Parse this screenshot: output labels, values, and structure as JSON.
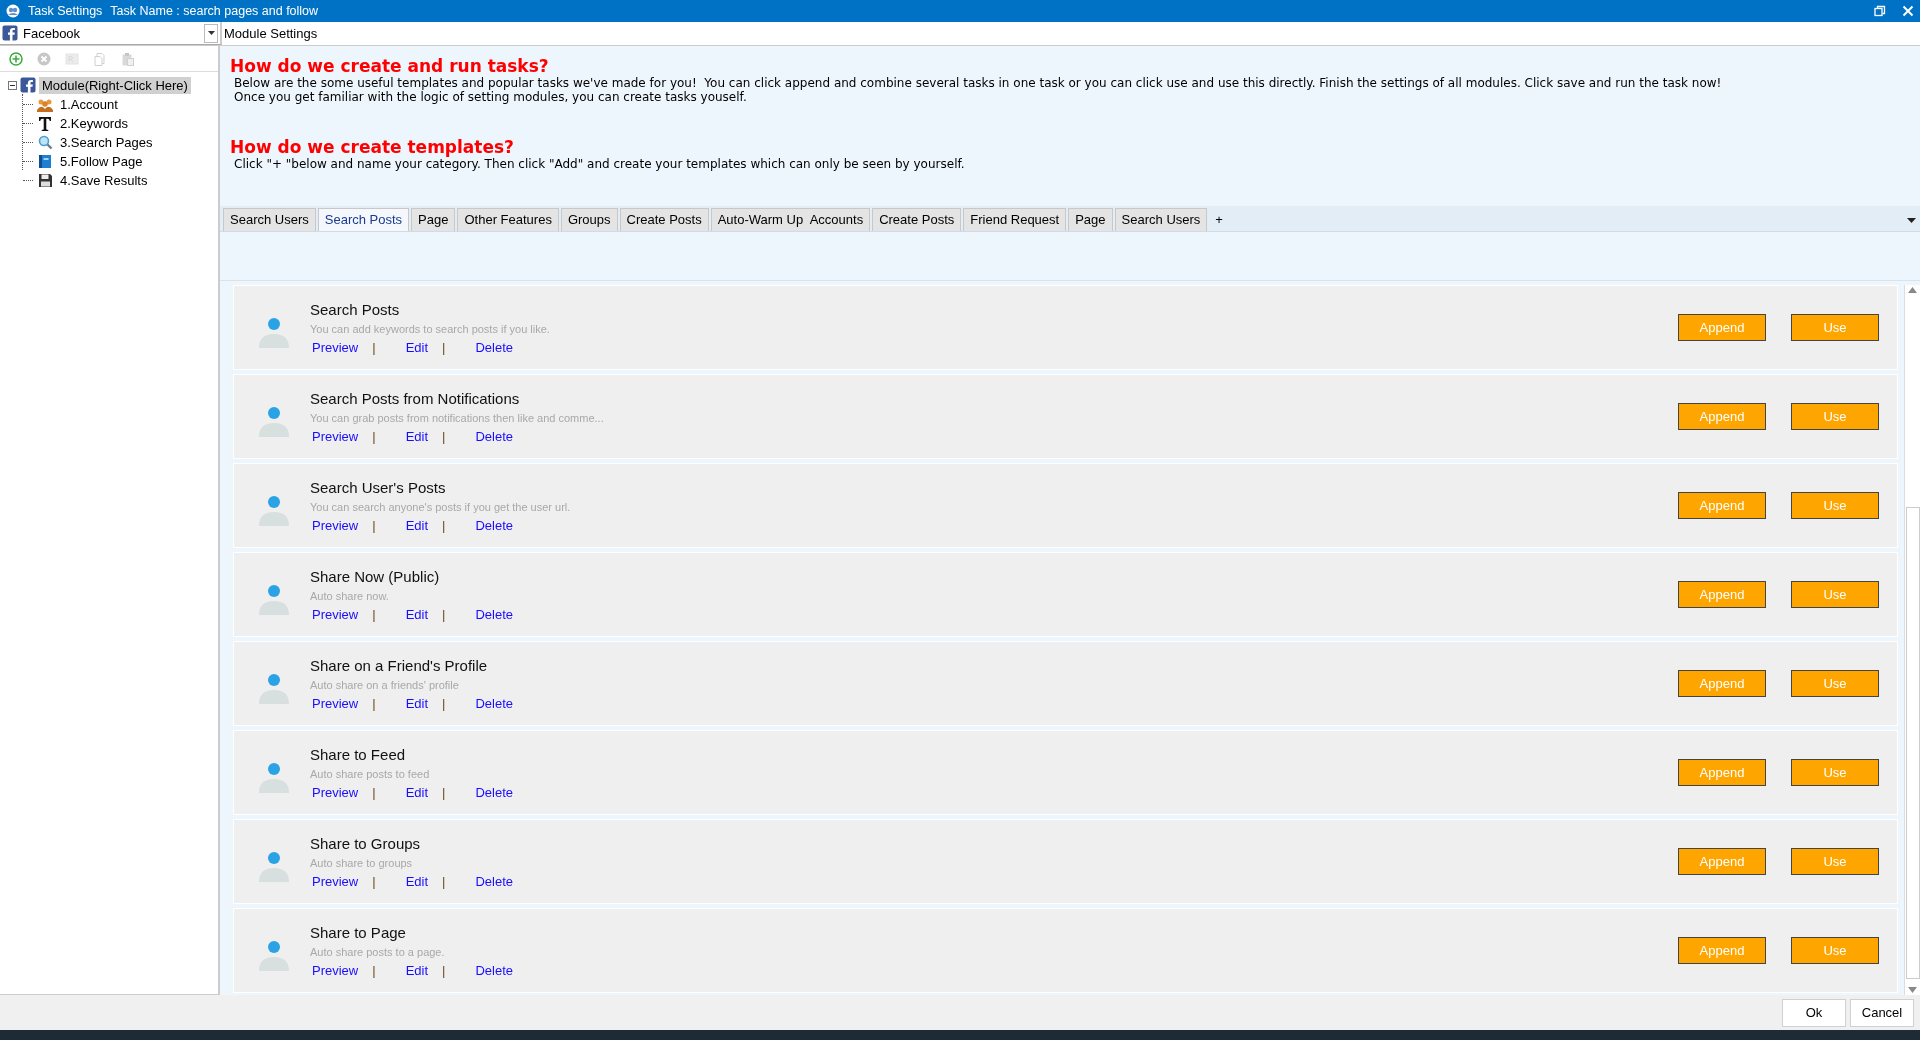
{
  "window": {
    "title": "Task Settings",
    "task_name": "Task Name : search pages and follow"
  },
  "module_selector": {
    "value": "Facebook"
  },
  "panel_title": "Module Settings",
  "toolbar": [
    {
      "kind": "add",
      "disabled": false
    },
    {
      "kind": "remove",
      "disabled": true
    },
    {
      "kind": "rename",
      "disabled": true
    },
    {
      "kind": "copy",
      "disabled": true
    },
    {
      "kind": "paste",
      "disabled": true
    }
  ],
  "tree": {
    "label": "Module(Right-Click Here)",
    "selected": true,
    "expanded": true,
    "children": [
      {
        "label": "1.Account",
        "kind": "account"
      },
      {
        "label": "2.Keywords",
        "kind": "keywords"
      },
      {
        "label": "3.Search Pages",
        "kind": "search"
      },
      {
        "label": "5.Follow Page",
        "kind": "book"
      },
      {
        "label": "4.Save Results",
        "kind": "save"
      }
    ]
  },
  "help": [
    {
      "heading": "How do we create and run tasks?",
      "lines": [
        "Below are the some useful templates and popular tasks we've made for you!  You can click append and combine several tasks in one task or you can click use and use this directly. Finish the settings of all modules. Click save and run the task now!",
        "Once you get familiar with the logic of setting modules, you can create tasks youself."
      ]
    },
    {
      "heading": "How do we create templates?",
      "lines": [
        "Click \"+ \"below and name your category. Then click \"Add\" and create your templates which can only be seen by yourself."
      ]
    }
  ],
  "tabs": [
    {
      "label": "Search Users",
      "selected": false
    },
    {
      "label": "Search Posts",
      "selected": true
    },
    {
      "label": "Page",
      "selected": false
    },
    {
      "label": "Other Features",
      "selected": false
    },
    {
      "label": "Groups",
      "selected": false
    },
    {
      "label": "Create Posts",
      "selected": false
    },
    {
      "label": "Auto-Warm Up  Accounts",
      "selected": false
    },
    {
      "label": "Create Posts",
      "selected": false
    },
    {
      "label": "Friend Request",
      "selected": false
    },
    {
      "label": "Page",
      "selected": false
    },
    {
      "label": "Search Users",
      "selected": false
    }
  ],
  "add_tab": "+",
  "templates": [
    {
      "title": "Search Posts",
      "description": "You can add keywords to search posts if you like.",
      "actions": [
        {
          "kind": "link",
          "text": "Preview"
        },
        {
          "kind": "separator",
          "text": "|"
        },
        {
          "kind": "link",
          "text": "Edit"
        },
        {
          "kind": "separator",
          "text": "|"
        },
        {
          "kind": "link",
          "text": "Delete"
        }
      ],
      "buttons": [
        "Append",
        "Use"
      ]
    },
    {
      "title": "Search Posts from Notifications",
      "description": "You can grab posts from notifications then like and comme...",
      "actions": [
        {
          "kind": "link",
          "text": "Preview"
        },
        {
          "kind": "separator",
          "text": "|"
        },
        {
          "kind": "link",
          "text": "Edit"
        },
        {
          "kind": "separator",
          "text": "|"
        },
        {
          "kind": "link",
          "text": "Delete"
        }
      ],
      "buttons": [
        "Append",
        "Use"
      ]
    },
    {
      "title": "Search User's Posts",
      "description": "You can search anyone's posts if you get the user url.",
      "actions": [
        {
          "kind": "link",
          "text": "Preview"
        },
        {
          "kind": "separator",
          "text": "|"
        },
        {
          "kind": "link",
          "text": "Edit"
        },
        {
          "kind": "separator",
          "text": "|"
        },
        {
          "kind": "link",
          "text": "Delete"
        }
      ],
      "buttons": [
        "Append",
        "Use"
      ]
    },
    {
      "title": "Share Now (Public)",
      "description": "Auto share now.",
      "actions": [
        {
          "kind": "link",
          "text": "Preview"
        },
        {
          "kind": "separator",
          "text": "|"
        },
        {
          "kind": "link",
          "text": "Edit"
        },
        {
          "kind": "separator",
          "text": "|"
        },
        {
          "kind": "link",
          "text": "Delete"
        }
      ],
      "buttons": [
        "Append",
        "Use"
      ]
    },
    {
      "title": "Share on a Friend's Profile",
      "description": "Auto share on a friends' profile",
      "actions": [
        {
          "kind": "link",
          "text": "Preview"
        },
        {
          "kind": "separator",
          "text": "|"
        },
        {
          "kind": "link",
          "text": "Edit"
        },
        {
          "kind": "separator",
          "text": "|"
        },
        {
          "kind": "link",
          "text": "Delete"
        }
      ],
      "buttons": [
        "Append",
        "Use"
      ]
    },
    {
      "title": "Share to Feed",
      "description": "Auto share posts to feed",
      "actions": [
        {
          "kind": "link",
          "text": "Preview"
        },
        {
          "kind": "separator",
          "text": "|"
        },
        {
          "kind": "link",
          "text": "Edit"
        },
        {
          "kind": "separator",
          "text": "|"
        },
        {
          "kind": "link",
          "text": "Delete"
        }
      ],
      "buttons": [
        "Append",
        "Use"
      ]
    },
    {
      "title": "Share to Groups",
      "description": "Auto share to groups",
      "actions": [
        {
          "kind": "link",
          "text": "Preview"
        },
        {
          "kind": "separator",
          "text": "|"
        },
        {
          "kind": "link",
          "text": "Edit"
        },
        {
          "kind": "separator",
          "text": "|"
        },
        {
          "kind": "link",
          "text": "Delete"
        }
      ],
      "buttons": [
        "Append",
        "Use"
      ]
    },
    {
      "title": "Share to Page",
      "description": "Auto share posts to a page.",
      "actions": [
        {
          "kind": "link",
          "text": "Preview"
        },
        {
          "kind": "separator",
          "text": "|"
        },
        {
          "kind": "link",
          "text": "Edit"
        },
        {
          "kind": "separator",
          "text": "|"
        },
        {
          "kind": "link",
          "text": "Delete"
        }
      ],
      "buttons": [
        "Append",
        "Use"
      ]
    }
  ],
  "footer_buttons": [
    "Ok",
    "Cancel"
  ]
}
